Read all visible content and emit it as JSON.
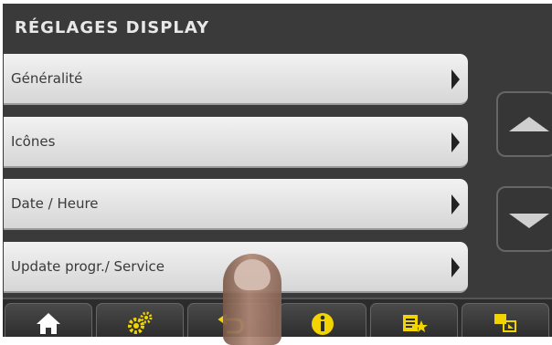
{
  "screen": {
    "title": "RÉGLAGES DISPLAY"
  },
  "menu": {
    "items": [
      {
        "label": "Généralité"
      },
      {
        "label": "Icônes"
      },
      {
        "label": "Date / Heure"
      },
      {
        "label": "Update progr./ Service"
      }
    ]
  },
  "scroll": {
    "up_icon": "triangle-up-icon",
    "down_icon": "triangle-down-icon"
  },
  "toolbar": {
    "buttons": [
      {
        "icon": "home-icon"
      },
      {
        "icon": "gears-icon"
      },
      {
        "icon": "back-arrow-icon"
      },
      {
        "icon": "info-icon"
      },
      {
        "icon": "favorites-list-icon"
      },
      {
        "icon": "screen-transfer-icon"
      }
    ],
    "accent_color": "#f2d400"
  }
}
